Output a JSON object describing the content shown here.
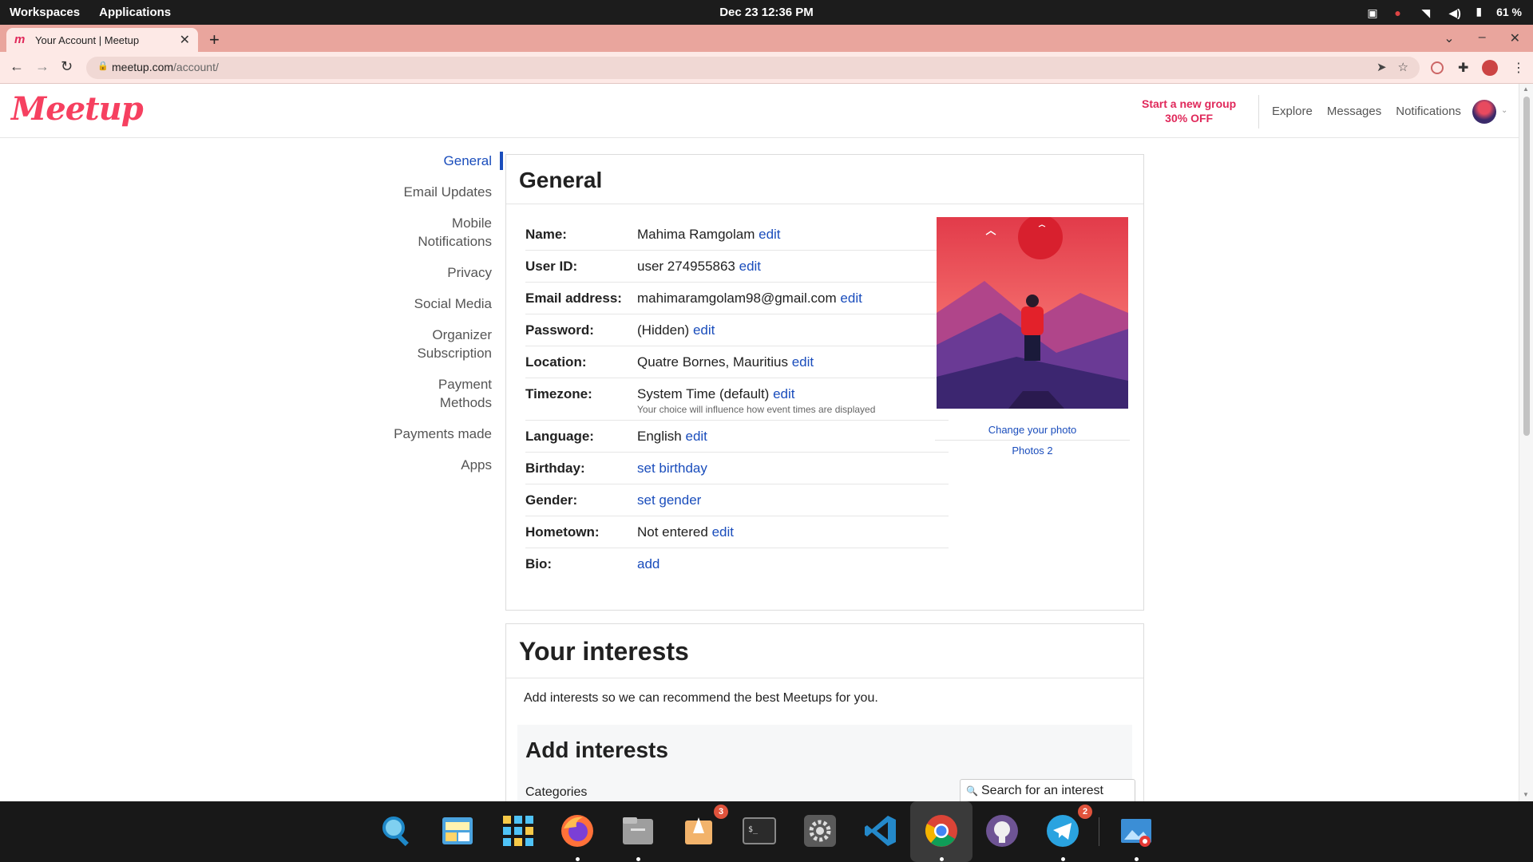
{
  "os": {
    "workspaces": "Workspaces",
    "applications": "Applications",
    "clock": "Dec 23  12:36 PM",
    "battery": "61 %"
  },
  "browser": {
    "tab_title": "Your Account | Meetup",
    "url_host": "meetup.com",
    "url_path": "/account/"
  },
  "header": {
    "logo": "Meetup",
    "start_group": "Start a new group",
    "discount": "30% OFF",
    "links": [
      "Explore",
      "Messages",
      "Notifications"
    ]
  },
  "sidebar": {
    "items": [
      {
        "label": "General",
        "active": true
      },
      {
        "label": "Email Updates"
      },
      {
        "label": "Mobile Notifications"
      },
      {
        "label": "Privacy"
      },
      {
        "label": "Social Media"
      },
      {
        "label": "Organizer Subscription"
      },
      {
        "label": "Payment Methods"
      },
      {
        "label": "Payments made"
      },
      {
        "label": "Apps"
      }
    ]
  },
  "general": {
    "title": "General",
    "rows": [
      {
        "label": "Name:",
        "value": "Mahima Ramgolam",
        "link": "edit"
      },
      {
        "label": "User ID:",
        "value": "user 274955863",
        "link": "edit"
      },
      {
        "label": "Email address:",
        "value": "mahimaramgolam98@gmail.com",
        "link": "edit"
      },
      {
        "label": "Password:",
        "value": "(Hidden)",
        "link": "edit"
      },
      {
        "label": "Location:",
        "value": "Quatre Bornes, Mauritius",
        "link": "edit"
      },
      {
        "label": "Timezone:",
        "value": "System Time (default)",
        "link": "edit",
        "note": "Your choice will influence how event times are displayed"
      },
      {
        "label": "Language:",
        "value": "English",
        "link": "edit"
      },
      {
        "label": "Birthday:",
        "value": "",
        "link": "set birthday"
      },
      {
        "label": "Gender:",
        "value": "",
        "link": "set gender"
      },
      {
        "label": "Hometown:",
        "value": "Not entered",
        "link": "edit"
      },
      {
        "label": "Bio:",
        "value": "",
        "link": "add"
      }
    ],
    "change_photo": "Change your photo",
    "photos": "Photos 2"
  },
  "interests": {
    "title": "Your interests",
    "intro": "Add interests so we can recommend the best Meetups for you.",
    "add_title": "Add interests",
    "categories_label": "Categories",
    "search_placeholder": "Search for an interest"
  },
  "dock": {
    "badge_files": "3",
    "badge_telegram": "2"
  },
  "colors": {
    "brand": "#f64060",
    "link": "#1a4dbc",
    "tab_strip": "#e9a59d"
  }
}
